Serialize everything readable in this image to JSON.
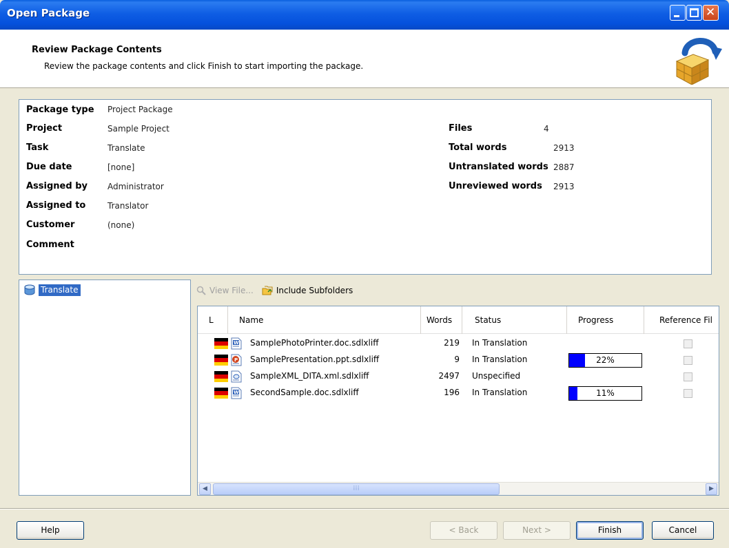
{
  "window": {
    "title": "Open Package"
  },
  "header": {
    "title": "Review Package Contents",
    "subtitle": "Review the package contents and click Finish to start importing the package."
  },
  "summary": {
    "left": [
      {
        "label": "Package type",
        "value": "Project Package"
      },
      {
        "label": "Project",
        "value": "Sample Project"
      },
      {
        "label": "Task",
        "value": "Translate"
      },
      {
        "label": "Due date",
        "value": "[none]"
      },
      {
        "label": "Assigned by",
        "value": "Administrator"
      },
      {
        "label": "Assigned to",
        "value": "Translator"
      },
      {
        "label": "Customer",
        "value": "(none)"
      },
      {
        "label": "Comment",
        "value": ""
      }
    ],
    "right": [
      {
        "label": "Files",
        "value": "4"
      },
      {
        "label": "Total words",
        "value": "2913"
      },
      {
        "label": "Untranslated words",
        "value": "2887"
      },
      {
        "label": "Unreviewed words",
        "value": "2913"
      }
    ]
  },
  "tree": {
    "items": [
      {
        "label": "Translate"
      }
    ]
  },
  "toolbar": {
    "view_file": "View File...",
    "include_subfolders": "Include Subfolders"
  },
  "filelist": {
    "columns": [
      "L",
      "Name",
      "Words",
      "Status",
      "Progress",
      "Reference Fil"
    ],
    "rows": [
      {
        "name": "SamplePhotoPrinter.doc.sdlxliff",
        "words": "219",
        "status": "In Translation",
        "progress": null,
        "icon": "word-doc-icon"
      },
      {
        "name": "SamplePresentation.ppt.sdlxliff",
        "words": "9",
        "status": "In Translation",
        "progress": 0.22,
        "progress_label": "22%",
        "icon": "powerpoint-icon"
      },
      {
        "name": "SampleXML_DITA.xml.sdlxliff",
        "words": "2497",
        "status": "Unspecified",
        "progress": null,
        "icon": "xml-file-icon"
      },
      {
        "name": "SecondSample.doc.sdlxliff",
        "words": "196",
        "status": "In Translation",
        "progress": 0.11,
        "progress_label": "11%",
        "icon": "word-doc-icon"
      }
    ]
  },
  "buttons": {
    "help": "Help",
    "back": "< Back",
    "next": "Next >",
    "finish": "Finish",
    "cancel": "Cancel"
  },
  "colors": {
    "titlebar": "#0a5fde",
    "selection": "#316ac5",
    "progress_fill": "#0000ff"
  }
}
